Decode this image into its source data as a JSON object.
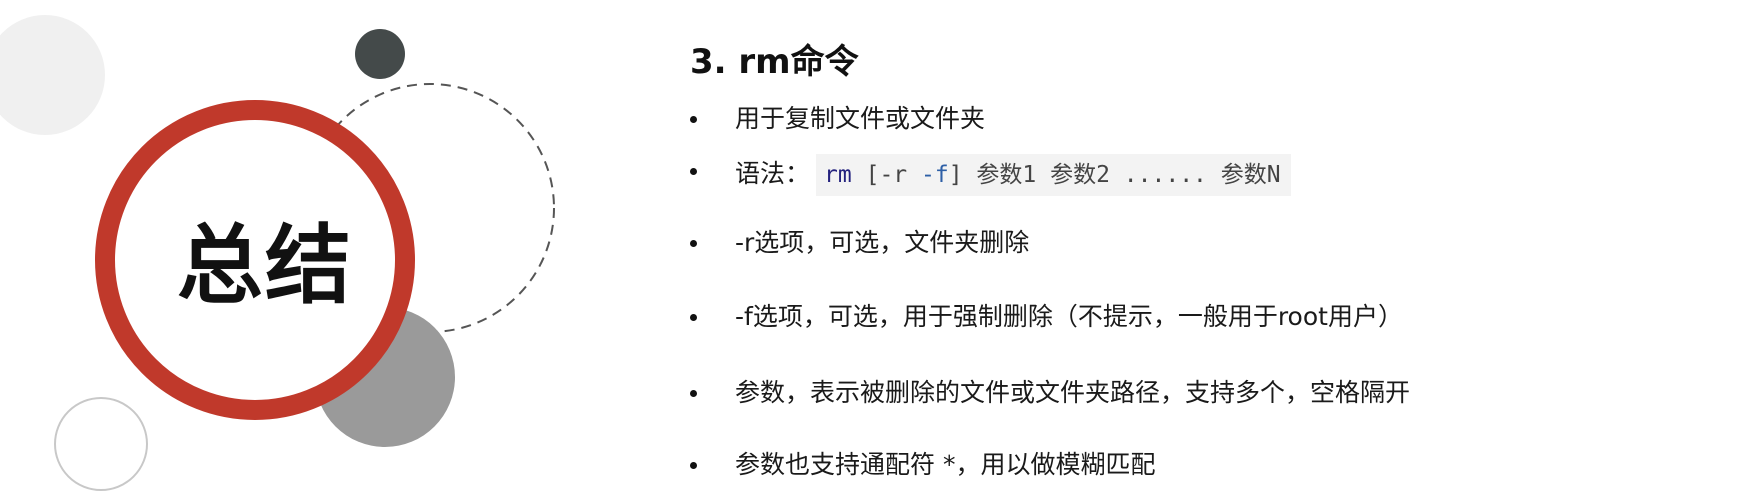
{
  "slide": {
    "title": "总结"
  },
  "section": {
    "heading": "3. rm命令",
    "bullets": [
      {
        "text": "用于复制文件或文件夹"
      },
      {
        "label": "语法：",
        "code": {
          "cmd": "rm",
          "bracket_open": "[",
          "opt_r": "-r",
          "opt_f": "-f",
          "bracket_close": "]",
          "args": "参数1 参数2 ...... 参数N"
        }
      },
      {
        "text": "-r选项，可选，文件夹删除"
      },
      {
        "text": "-f选项，可选，用于强制删除（不提示，一般用于root用户）"
      },
      {
        "text": "参数，表示被删除的文件或文件夹路径，支持多个，空格隔开"
      },
      {
        "text": "参数也支持通配符 *，用以做模糊匹配"
      }
    ]
  },
  "colors": {
    "ring": "#c0392b",
    "dark_circle": "#444a4a",
    "gray_circle": "#9a9a9a",
    "light_circle": "#f0f0f0"
  }
}
